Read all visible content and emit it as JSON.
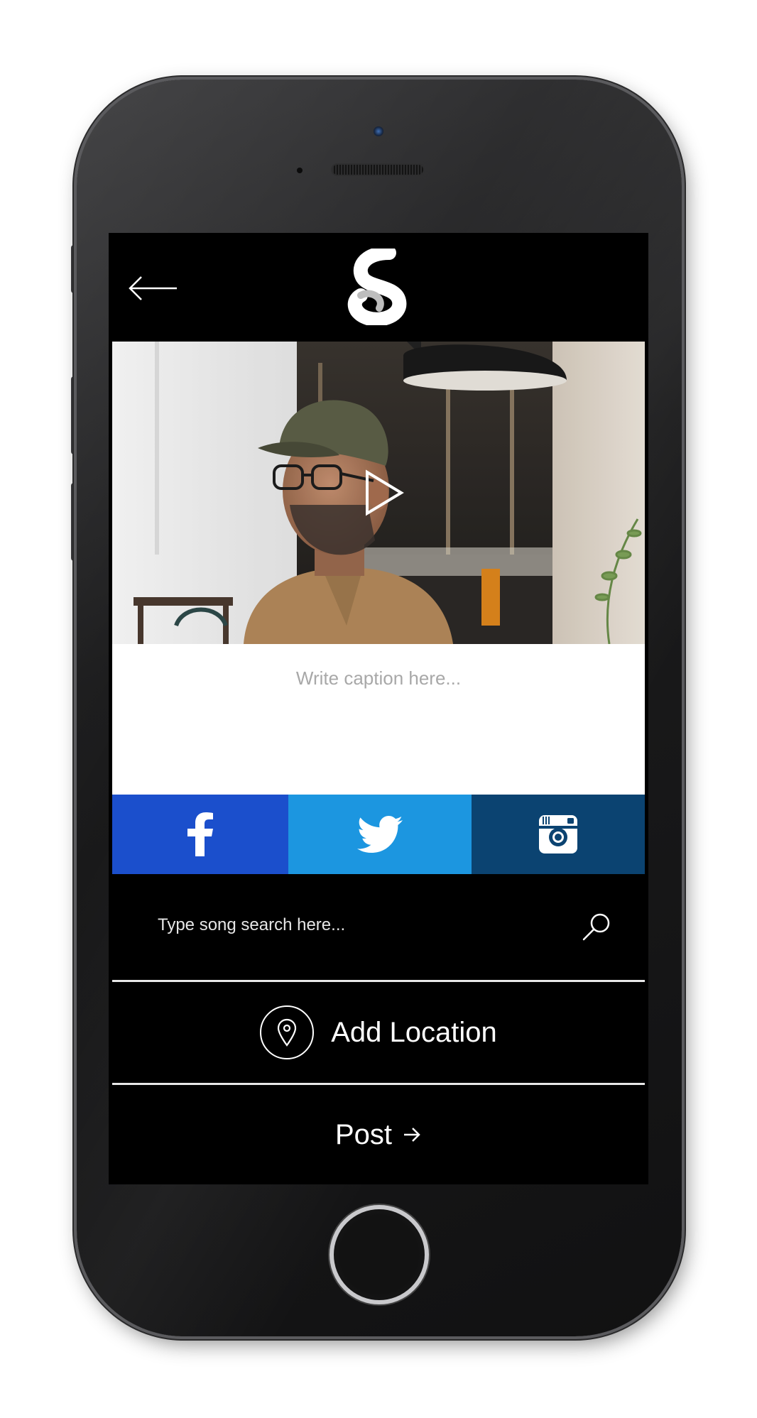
{
  "app": {
    "back_label": "Back",
    "logo_icon": "s-logo-icon"
  },
  "media": {
    "play_icon": "play-icon",
    "description": ""
  },
  "caption": {
    "placeholder": "Write caption here..."
  },
  "share": {
    "items": [
      {
        "name": "facebook",
        "icon": "facebook-icon",
        "color": "#1b4fcc"
      },
      {
        "name": "twitter",
        "icon": "twitter-icon",
        "color": "#1c96e0"
      },
      {
        "name": "instagram",
        "icon": "instagram-icon",
        "color": "#0b4371"
      }
    ]
  },
  "search": {
    "placeholder": "Type song search here...",
    "icon": "search-icon"
  },
  "location": {
    "label": "Add Location",
    "icon": "location-pin-icon"
  },
  "post": {
    "label": "Post",
    "icon": "arrow-right-icon"
  },
  "colors": {
    "background": "#000000",
    "text": "#ffffff",
    "caption_bg": "#ffffff",
    "placeholder": "#a8a8a8"
  }
}
